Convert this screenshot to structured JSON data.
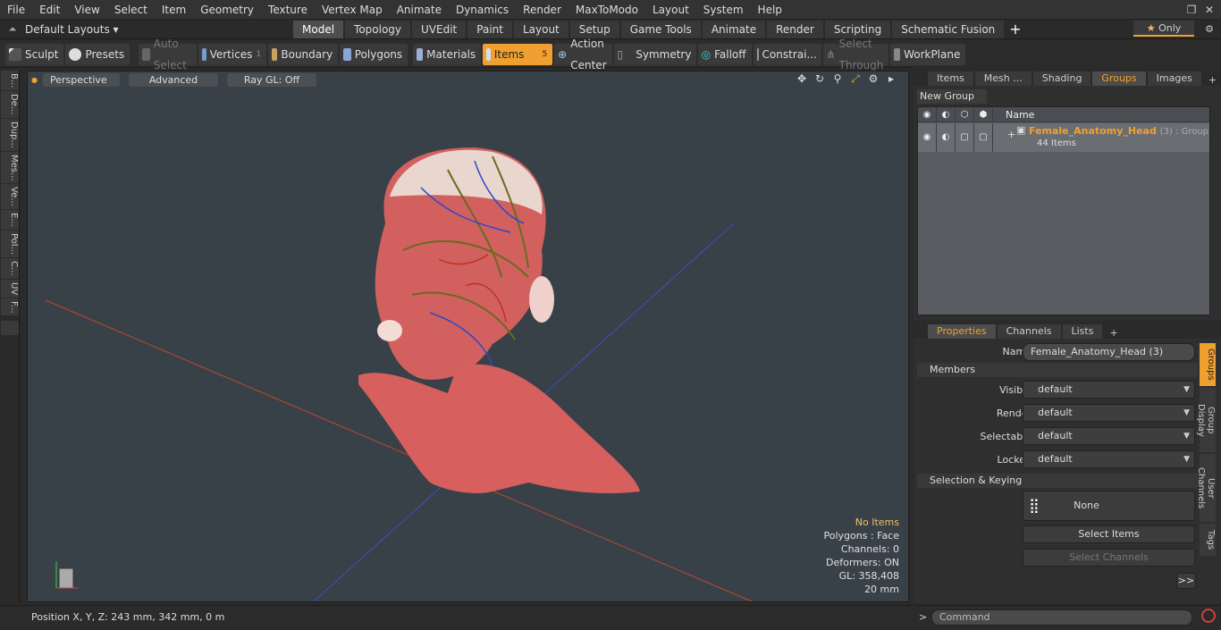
{
  "menu": [
    "File",
    "Edit",
    "View",
    "Select",
    "Item",
    "Geometry",
    "Texture",
    "Vertex Map",
    "Animate",
    "Dynamics",
    "Render",
    "MaxToModo",
    "Layout",
    "System",
    "Help"
  ],
  "layouts_label": "Default Layouts",
  "layout_tabs": [
    {
      "label": "Model",
      "active": true
    },
    {
      "label": "Topology",
      "active": false
    },
    {
      "label": "UVEdit",
      "active": false
    },
    {
      "label": "Paint",
      "active": false
    },
    {
      "label": "Layout",
      "active": false
    },
    {
      "label": "Setup",
      "active": false
    },
    {
      "label": "Game Tools",
      "active": false
    },
    {
      "label": "Animate",
      "active": false
    },
    {
      "label": "Render",
      "active": false
    },
    {
      "label": "Scripting",
      "active": false
    },
    {
      "label": "Schematic Fusion",
      "active": false
    }
  ],
  "only_label": "Only",
  "toolbar": {
    "sculpt": "Sculpt",
    "presets": "Presets",
    "auto_select": "Auto Select",
    "vertices": "Vertices",
    "vertices_count": "1",
    "boundary": "Boundary",
    "polygons": "Polygons",
    "materials": "Materials",
    "items": "Items",
    "items_count": "5",
    "action_center": "Action Center",
    "symmetry": "Symmetry",
    "falloff": "Falloff",
    "constraints": "Constrai...",
    "select_through": "Select Through",
    "workplane": "WorkPlane"
  },
  "left_tabs": [
    "B...",
    "De...",
    "Dup...",
    "Mes...",
    "Ve...",
    "E...",
    "Pol...",
    "C...",
    "UV",
    "F..."
  ],
  "viewport": {
    "perspective": "Perspective",
    "advanced": "Advanced",
    "raygl": "Ray GL: Off",
    "stats": {
      "no_items": "No Items",
      "polygons": "Polygons : Face",
      "channels": "Channels: 0",
      "deformers": "Deformers: ON",
      "gl": "GL: 358,408",
      "scale": "20 mm"
    }
  },
  "status": "Position X, Y, Z:   243 mm, 342 mm, 0 m",
  "top_panel": {
    "tabs": [
      {
        "label": "Items",
        "active": false
      },
      {
        "label": "Mesh ...",
        "active": false
      },
      {
        "label": "Shading",
        "active": false
      },
      {
        "label": "Groups",
        "active": true
      },
      {
        "label": "Images",
        "active": false
      }
    ],
    "new_group": "New Group",
    "col_name": "Name",
    "group_name": "Female_Anatomy_Head",
    "group_suffix": "(3) : Group",
    "group_items": "44 Items"
  },
  "properties": {
    "tabs": [
      {
        "label": "Properties",
        "active": true
      },
      {
        "label": "Channels",
        "active": false
      },
      {
        "label": "Lists",
        "active": false
      }
    ],
    "name_label": "Name",
    "name_value": "Female_Anatomy_Head (3)",
    "members": "Members",
    "visible_label": "Visible",
    "visible_value": "default",
    "render_label": "Render",
    "render_value": "default",
    "selectable_label": "Selectable",
    "selectable_value": "default",
    "locked_label": "Locked",
    "locked_value": "default",
    "selection_keying": "Selection & Keying",
    "none": "None",
    "select_items": "Select Items",
    "select_channels": "Select Channels",
    "more": ">>"
  },
  "side_tabs": [
    {
      "label": "Groups",
      "active": true
    },
    {
      "label": "Group Display",
      "active": false
    },
    {
      "label": "User Channels",
      "active": false
    },
    {
      "label": "Tags",
      "active": false
    }
  ],
  "command_placeholder": "Command",
  "colors": {
    "accent": "#f0a030",
    "viewport_bg": "#394148"
  }
}
